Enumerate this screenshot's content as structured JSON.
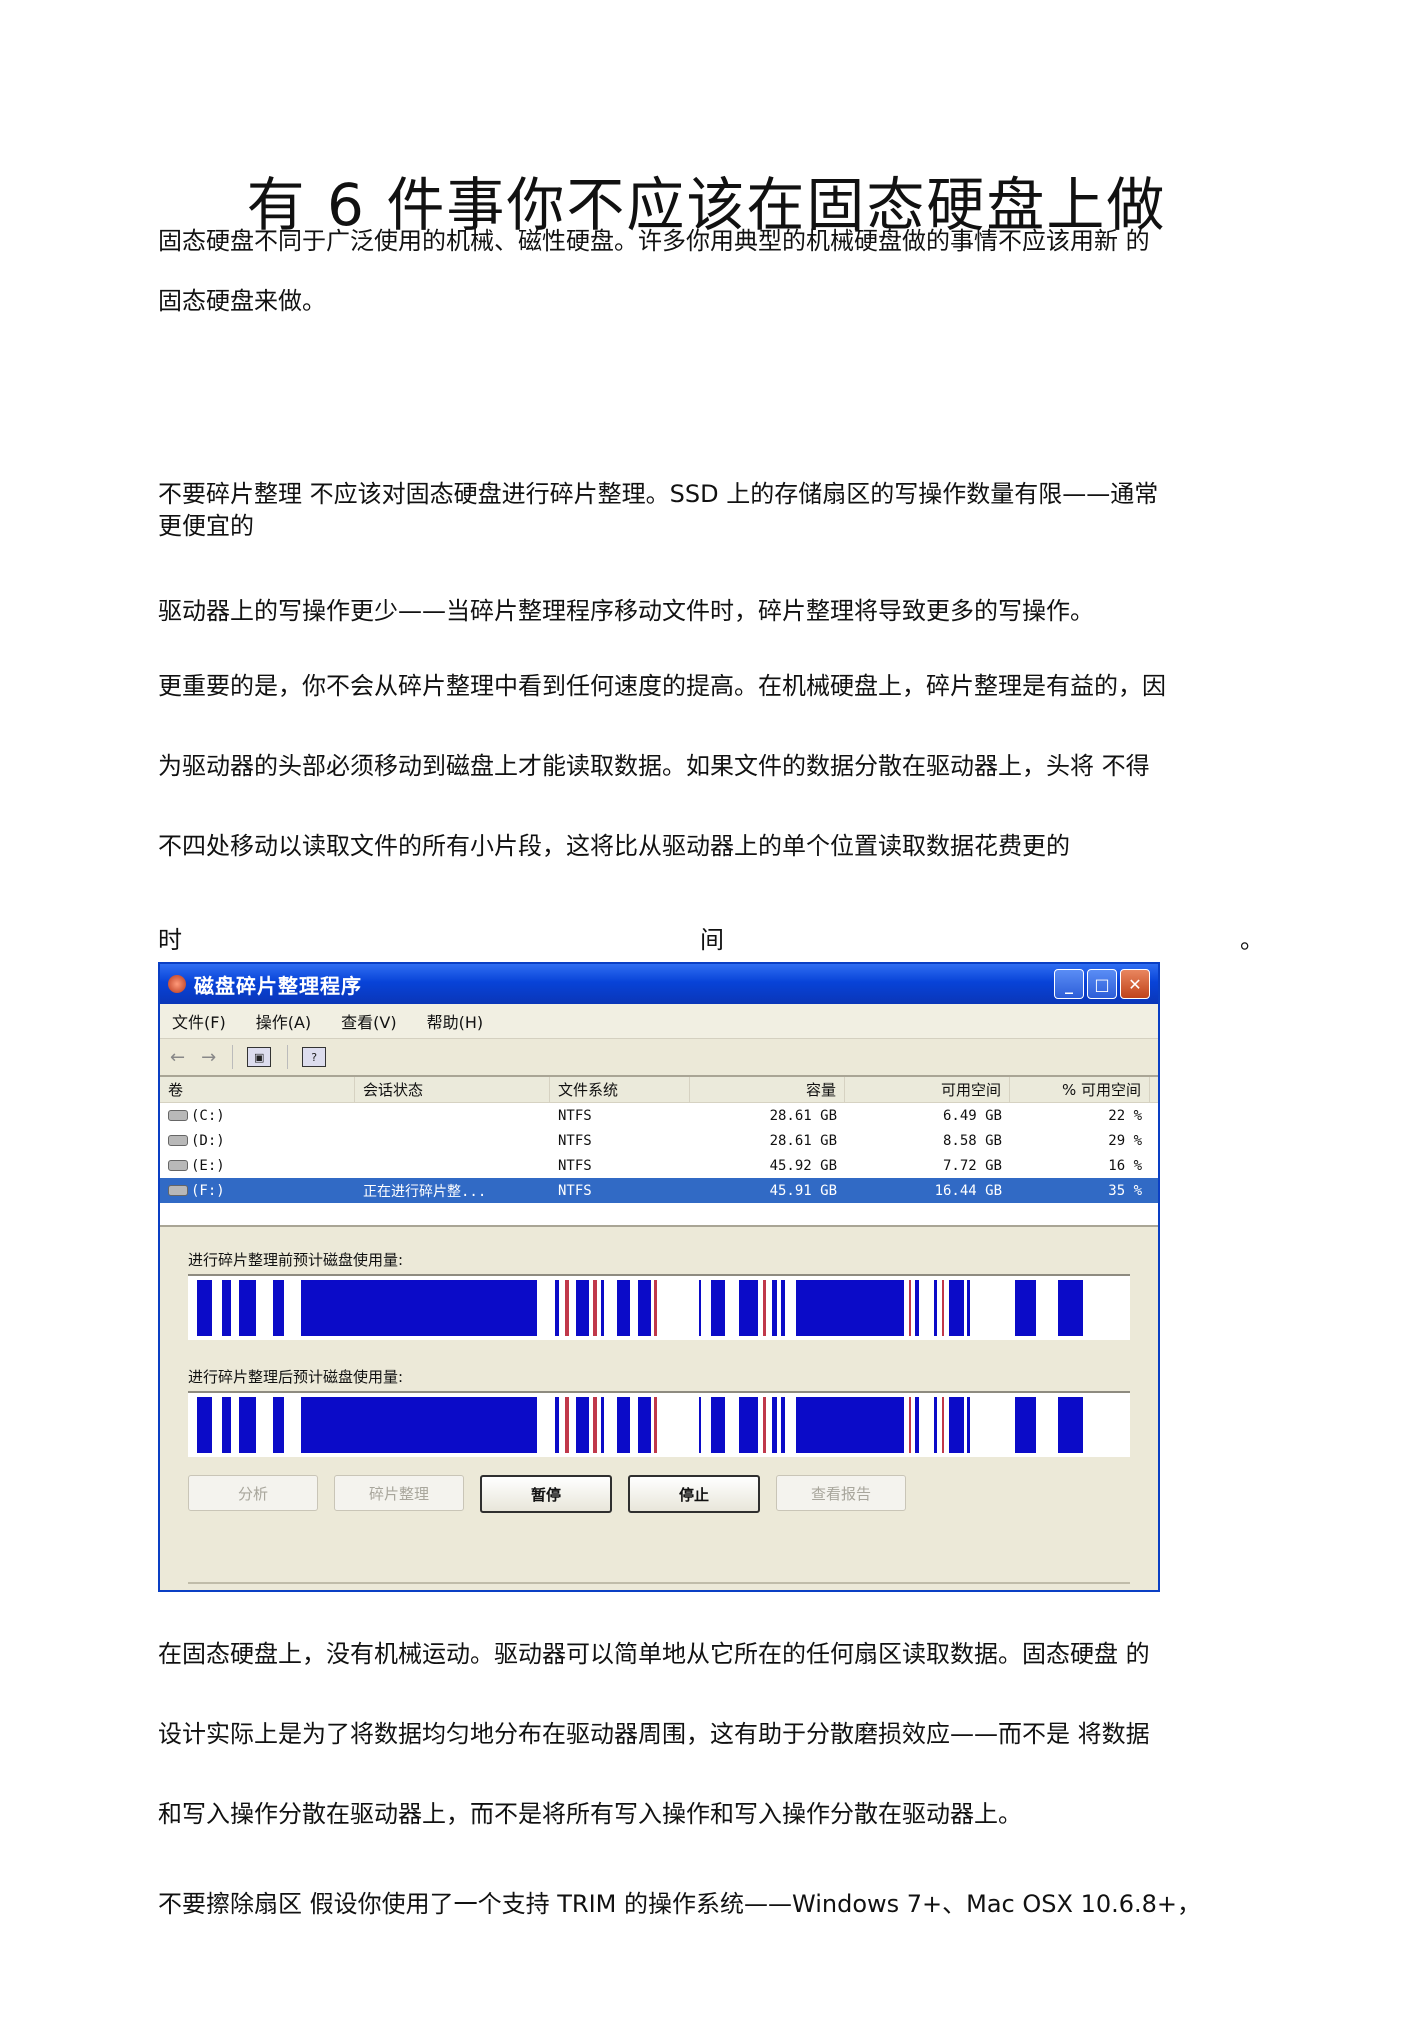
{
  "title": "有 6 件事你不应该在固态硬盘上做",
  "paragraphs": {
    "intro_1": "固态硬盘不同于广泛使用的机械、磁性硬盘。许多你用典型的机械硬盘做的事情不应该用新 的",
    "intro_2": "固态硬盘来做。",
    "defrag_1": "不要碎片整理 不应该对固态硬盘进行碎片整理。SSD 上的存储扇区的写操作数量有限——通常",
    "defrag_2": "更便宜的",
    "defrag_3": "驱动器上的写操作更少——当碎片整理程序移动文件时，碎片整理将导致更多的写操作。",
    "defrag_4": "更重要的是，你不会从碎片整理中看到任何速度的提高。在机械硬盘上，碎片整理是有益的，因",
    "defrag_5": "为驱动器的头部必须移动到磁盘上才能读取数据。如果文件的数据分散在驱动器上，头将 不得",
    "defrag_6": "不四处移动以读取文件的所有小片段，这将比从驱动器上的单个位置读取数据花费更的",
    "defrag_7a": "时",
    "defrag_7b": "间",
    "defrag_7c": "。",
    "ssd_1": "在固态硬盘上，没有机械运动。驱动器可以简单地从它所在的任何扇区读取数据。固态硬盘 的",
    "ssd_2": "设计实际上是为了将数据均匀地分布在驱动器周围，这有助于分散磨损效应——而不是 将数据",
    "ssd_3": "和写入操作分散在驱动器上，而不是将所有写入操作和写入操作分散在驱动器上。",
    "trim_1": "不要擦除扇区 假设你使用了一个支持 TRIM 的操作系统——Windows 7+、Mac OSX 10.6.8+，"
  },
  "screenshot": {
    "window_title": "磁盘碎片整理程序",
    "window_buttons": {
      "minimize": "_",
      "maximize": "□",
      "close": "✕"
    },
    "menu": [
      "文件(F)",
      "操作(A)",
      "查看(V)",
      "帮助(H)"
    ],
    "toolbar": {
      "back": "←",
      "forward": "→",
      "view_icon": "▣",
      "help_icon": "?"
    },
    "columns": [
      "卷",
      "会话状态",
      "文件系统",
      "容量",
      "可用空间",
      "% 可用空间"
    ],
    "volumes": [
      {
        "name": "(C:)",
        "status": "",
        "fs": "NTFS",
        "capacity": "28.61 GB",
        "free": "6.49 GB",
        "pct": "22 %"
      },
      {
        "name": "(D:)",
        "status": "",
        "fs": "NTFS",
        "capacity": "28.61 GB",
        "free": "8.58 GB",
        "pct": "29 %"
      },
      {
        "name": "(E:)",
        "status": "",
        "fs": "NTFS",
        "capacity": "45.92 GB",
        "free": "7.72 GB",
        "pct": "16 %"
      },
      {
        "name": "(F:)",
        "status": "正在进行碎片整...",
        "fs": "NTFS",
        "capacity": "45.91 GB",
        "free": "16.44 GB",
        "pct": "35 %"
      }
    ],
    "selected_volume": "(F:)",
    "before_label": "进行碎片整理前预计磁盘使用量:",
    "after_label": "进行碎片整理后预计磁盘使用量:",
    "colors": {
      "used": "#0b0bc8",
      "fragmented": "#c0384a",
      "free": "#ffffff",
      "system": "#2d9e4a"
    },
    "buttons": [
      {
        "label": "分析",
        "enabled": false
      },
      {
        "label": "碎片整理",
        "enabled": false
      },
      {
        "label": "暂停",
        "enabled": true
      },
      {
        "label": "停止",
        "enabled": true
      },
      {
        "label": "查看报告",
        "enabled": false
      }
    ]
  }
}
